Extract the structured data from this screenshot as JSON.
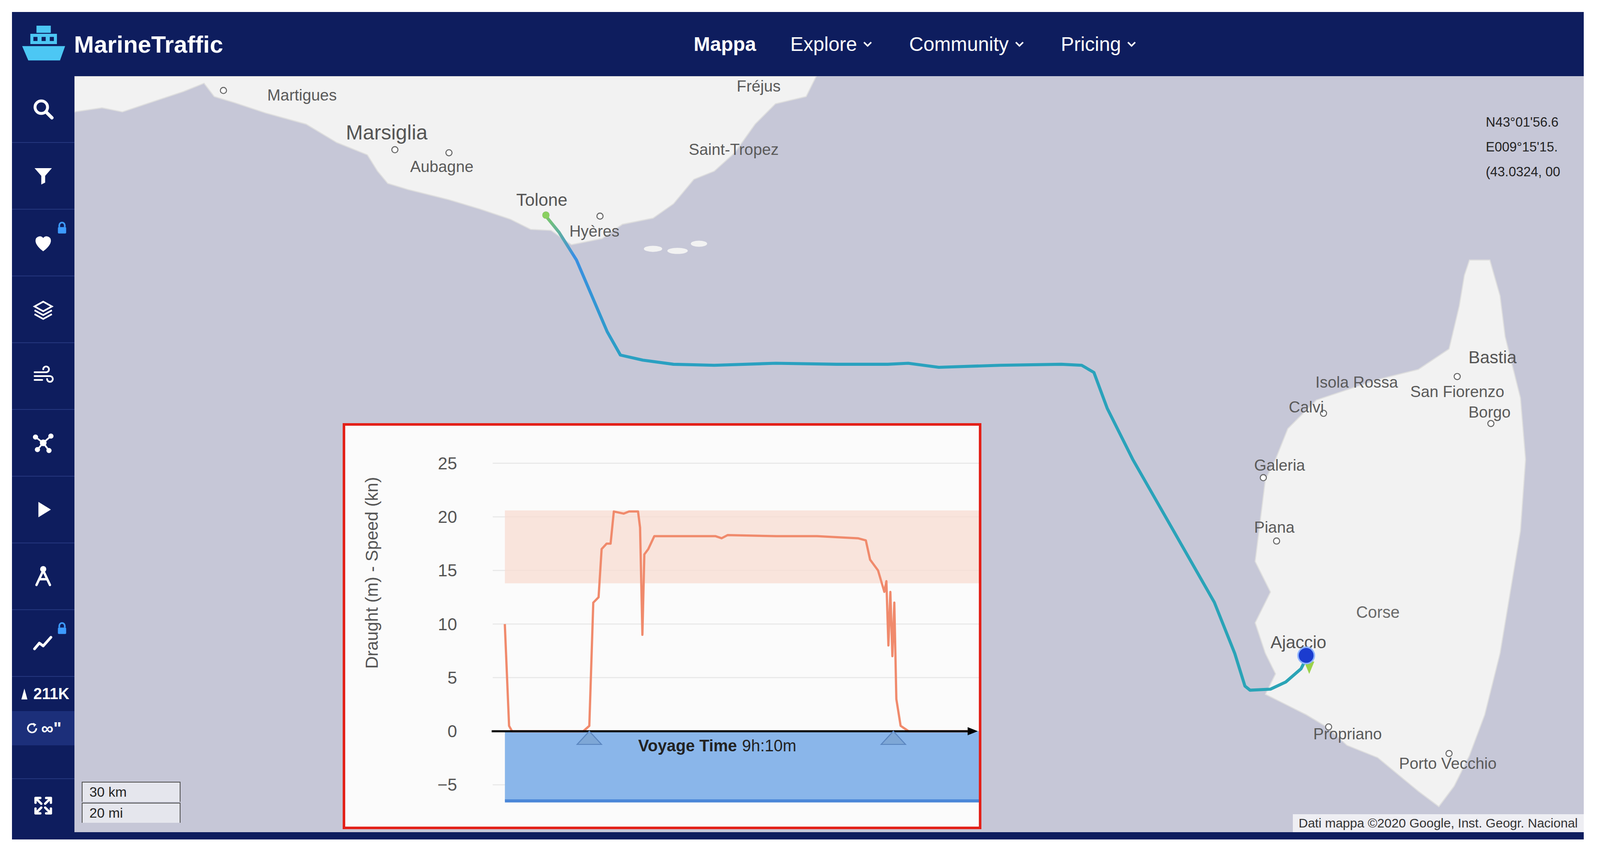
{
  "topbar": {
    "logo": "MarineTraffic",
    "nav": [
      {
        "label": "Mappa",
        "selected": true,
        "dropdown": false
      },
      {
        "label": "Explore",
        "selected": false,
        "dropdown": true
      },
      {
        "label": "Community",
        "selected": false,
        "dropdown": true
      },
      {
        "label": "Pricing",
        "selected": false,
        "dropdown": true
      }
    ]
  },
  "sidebar": {
    "items": [
      {
        "locked": false
      },
      {
        "locked": false
      },
      {
        "locked": true
      },
      {
        "locked": false
      },
      {
        "locked": false
      },
      {
        "locked": false
      },
      {
        "locked": false
      },
      {
        "locked": false
      },
      {
        "locked": true
      }
    ],
    "fleet_count": "211K",
    "refresh": "∞\""
  },
  "map": {
    "coordinates": [
      "N43°01'56.6",
      "E009°15'15.",
      "(43.0324, 00"
    ],
    "places": [
      {
        "name": "Martigues",
        "kind": "town"
      },
      {
        "name": "Marsiglia",
        "kind": "city"
      },
      {
        "name": "Aubagne",
        "kind": "town"
      },
      {
        "name": "Fréjus",
        "kind": "town"
      },
      {
        "name": "Saint-Tropez",
        "kind": "town"
      },
      {
        "name": "Tolone",
        "kind": "major"
      },
      {
        "name": "Hyères",
        "kind": "town"
      },
      {
        "name": "Isola Rossa",
        "kind": "town"
      },
      {
        "name": "Calvi",
        "kind": "town"
      },
      {
        "name": "Bastia",
        "kind": "major"
      },
      {
        "name": "San Fiorenzo",
        "kind": "town"
      },
      {
        "name": "Borgo",
        "kind": "town"
      },
      {
        "name": "Galeria",
        "kind": "town"
      },
      {
        "name": "Piana",
        "kind": "town"
      },
      {
        "name": "Corse",
        "kind": "region"
      },
      {
        "name": "Ajaccio",
        "kind": "major"
      },
      {
        "name": "Propriano",
        "kind": "town"
      },
      {
        "name": "Porto Vecchio",
        "kind": "town"
      }
    ],
    "scale": [
      "30 km",
      "20 mi"
    ],
    "attribution": "Dati mappa ©2020 Google, Inst. Geogr. Nacional"
  },
  "chart": {
    "y_label": "Draught (m) - Speed (kn)",
    "y_ticks": [
      "25",
      "20",
      "15",
      "10",
      "5",
      "0",
      "−5"
    ],
    "x_label": {
      "label": "Voyage Time",
      "value": "9h:10m"
    },
    "speed_band": {
      "from": 13.8,
      "to": 20.6
    },
    "draught_area": {
      "from": -6.5,
      "to": 0
    },
    "markers": [
      {
        "time_h": 0
      },
      {
        "time_h": 9.17
      }
    ],
    "series": [
      {
        "time_h": [
          -2.55,
          -2.42,
          -2.33,
          -0.18,
          0,
          0.12,
          0.28,
          0.37,
          0.52,
          0.64,
          0.74,
          1.04,
          1.2,
          1.47,
          1.53,
          1.6,
          1.66,
          1.78,
          1.96,
          3.8,
          3.99,
          4.17,
          5.64,
          6.87,
          8.1,
          8.34,
          8.47,
          8.71,
          8.9,
          8.96,
          9.02,
          9.08,
          9.14,
          9.2,
          9.26,
          9.39,
          9.63,
          11.63
        ],
        "values": [
          10,
          0.5,
          0,
          0,
          0.5,
          12,
          12.5,
          17,
          17.5,
          17.5,
          20.5,
          20.3,
          20.5,
          20.5,
          19,
          9,
          16.5,
          17,
          18.2,
          18.2,
          18,
          18.3,
          18.2,
          18.2,
          18,
          17.8,
          16,
          15,
          13,
          14,
          8,
          13,
          7,
          12,
          3,
          0.5,
          0,
          0
        ]
      }
    ]
  }
}
